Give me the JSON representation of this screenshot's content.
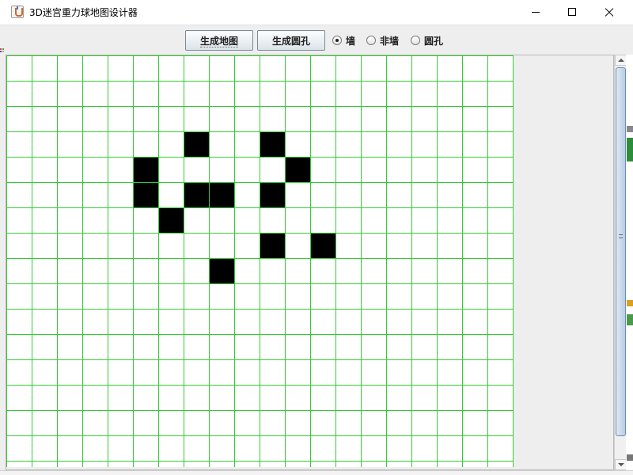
{
  "window": {
    "title": "3D迷宫重力球地图设计器"
  },
  "toolbar": {
    "generate_map_label": "生成地图",
    "generate_hole_label": "生成圆孔",
    "radios": [
      {
        "label": "墙",
        "checked": true
      },
      {
        "label": "非墙",
        "checked": false
      },
      {
        "label": "圆孔",
        "checked": false
      }
    ]
  },
  "grid": {
    "columns": 20,
    "rows": 16,
    "line_color": "#33cc33",
    "wall_color": "#000000",
    "empty_color": "#ffffff",
    "wall_cells": [
      [
        3,
        7
      ],
      [
        3,
        10
      ],
      [
        4,
        5
      ],
      [
        4,
        11
      ],
      [
        5,
        5
      ],
      [
        5,
        7
      ],
      [
        5,
        8
      ],
      [
        5,
        10
      ],
      [
        6,
        6
      ],
      [
        7,
        10
      ],
      [
        7,
        12
      ],
      [
        8,
        8
      ]
    ]
  },
  "colors": {
    "window_bg": "#eeeeee",
    "scroll_thumb": "#c9d8ea"
  }
}
